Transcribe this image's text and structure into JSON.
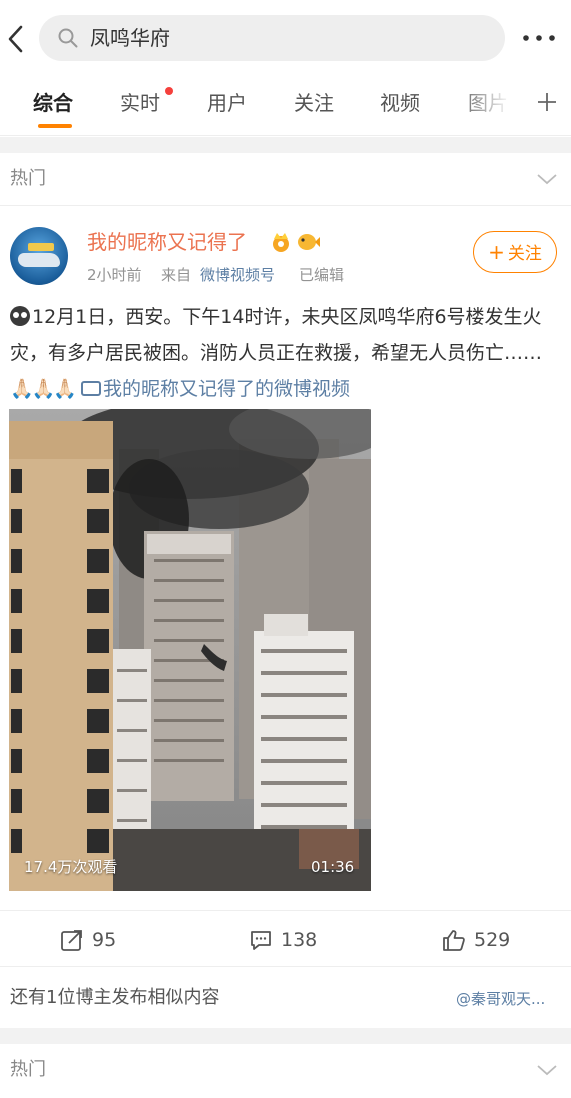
{
  "search": {
    "query": "凤鸣华府"
  },
  "tabs": [
    {
      "label": "综合"
    },
    {
      "label": "实时"
    },
    {
      "label": "用户"
    },
    {
      "label": "关注"
    },
    {
      "label": "视频"
    },
    {
      "label": "图片"
    }
  ],
  "colors": {
    "accent": "#ff8200",
    "username": "#eb7350",
    "link": "#5d7fa4",
    "dot": "#f5403c"
  },
  "section1": {
    "label": "热门"
  },
  "post": {
    "username": "我的昵称又记得了",
    "time": "2小时前",
    "from": "来自",
    "source": "微博视频号",
    "edited": "已编辑",
    "follow_label": "关注",
    "text": "12月1日，西安。下午14时许，未央区凤鸣华府6号楼发生火灾，有多户居民被困。消防人员正在救援，希望无人员伤亡……",
    "hands": "🙏🏻🙏🏻🙏🏻",
    "video_link": "我的昵称又记得了的微博视频",
    "video": {
      "views": "17.4万次观看",
      "duration": "01:36"
    },
    "reposts": "95",
    "comments": "138",
    "likes": "529"
  },
  "similar": {
    "text": "还有1位博主发布相似内容",
    "author": "@秦哥观天..."
  },
  "section2": {
    "label": "热门"
  }
}
